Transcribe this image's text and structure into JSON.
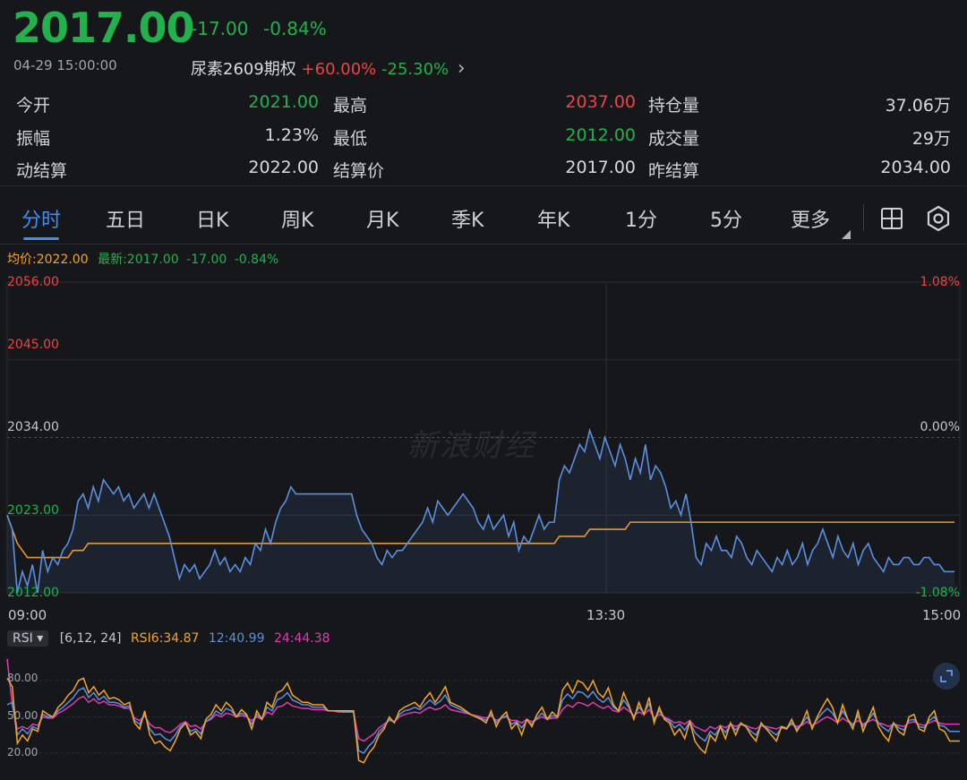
{
  "quote": {
    "price": "2017.00",
    "change": "-17.00",
    "change_pct": "-0.84%",
    "timestamp": "04-29 15:00:00",
    "option_name": "尿素2609期权",
    "option_up": "+60.00%",
    "option_down": "-25.30%",
    "option_arrow": "›"
  },
  "stats": {
    "open_label": "今开",
    "open": "2021.00",
    "high_label": "最高",
    "high": "2037.00",
    "oi_label": "持仓量",
    "oi": "37.06万",
    "amp_label": "振幅",
    "amp": "1.23%",
    "low_label": "最低",
    "low": "2012.00",
    "vol_label": "成交量",
    "vol": "29万",
    "settle_label": "动结算",
    "settle": "2022.00",
    "settle_price_label": "结算价",
    "settle_price": "2017.00",
    "prev_settle_label": "昨结算",
    "prev_settle": "2034.00"
  },
  "tabs": [
    "分时",
    "五日",
    "日K",
    "周K",
    "月K",
    "季K",
    "年K",
    "1分",
    "5分",
    "更多"
  ],
  "legend": {
    "avg": "均价:2022.00",
    "latest": "最新:2017.00",
    "chg": "-17.00",
    "pct": "-0.84%"
  },
  "watermark": "新浪财经",
  "colors": {
    "price_line": "#5b8fe0",
    "avg_line": "#e69a2e",
    "rsi6": "#f5a623",
    "rsi12": "#5b8fe0",
    "rsi24": "#e03bb4",
    "up": "#ef4343",
    "down": "#22b14c"
  },
  "rsi": {
    "select_label": "RSI ▾",
    "params": "[6,12, 24]",
    "rsi6_label": "RSI6:34.87",
    "rsi12_label": "12:40.99",
    "rsi24_label": "24:44.38",
    "ticks": [
      "80.00",
      "50.00",
      "20.00"
    ]
  },
  "chart_data": [
    {
      "type": "line",
      "title": "",
      "y_ticks_left": [
        "2056.00",
        "2045.00",
        "2034.00",
        "2023.00",
        "2012.00"
      ],
      "y_ticks_right": [
        "1.08%",
        "0.00%",
        "-1.08%"
      ],
      "x_ticks": [
        "09:00",
        "13:30",
        "15:00"
      ],
      "ylim": [
        2012,
        2056
      ],
      "reference": 2034,
      "series": [
        {
          "name": "最新",
          "values": [
            2023,
            2021,
            2012,
            2015,
            2013,
            2016,
            2012,
            2018,
            2015,
            2017,
            2016,
            2018,
            2019,
            2021,
            2025,
            2026,
            2024,
            2027,
            2025,
            2028,
            2027,
            2026,
            2027,
            2025,
            2026,
            2024,
            2025,
            2026,
            2024,
            2026,
            2024,
            2022,
            2020,
            2017,
            2014,
            2016,
            2015,
            2016,
            2014,
            2015,
            2016,
            2018,
            2016,
            2017,
            2015,
            2016,
            2015,
            2017,
            2016,
            2019,
            2018,
            2021,
            2019,
            2022,
            2024,
            2025,
            2027,
            2026,
            2026,
            2026,
            2026,
            2026,
            2026,
            2026,
            2026,
            2026,
            2026,
            2026,
            2026,
            2023,
            2021,
            2020,
            2019,
            2017,
            2016,
            2018,
            2017,
            2018,
            2018,
            2019,
            2020,
            2021,
            2022,
            2024,
            2022,
            2025,
            2024,
            2023,
            2024,
            2025,
            2026,
            2025,
            2024,
            2022,
            2021,
            2023,
            2021,
            2022,
            2023,
            2020,
            2022,
            2018,
            2020,
            2019,
            2021,
            2023,
            2021,
            2022,
            2022,
            2028,
            2030,
            2029,
            2031,
            2033,
            2032,
            2035,
            2033,
            2031,
            2034,
            2032,
            2030,
            2033,
            2031,
            2028,
            2031,
            2029,
            2033,
            2028,
            2030,
            2029,
            2027,
            2024,
            2025,
            2023,
            2026,
            2022,
            2017,
            2016,
            2019,
            2018,
            2020,
            2018,
            2018,
            2017,
            2020,
            2019,
            2017,
            2016,
            2018,
            2017,
            2016,
            2015,
            2017,
            2016,
            2018,
            2016,
            2017,
            2019,
            2016,
            2018,
            2019,
            2021,
            2019,
            2017,
            2020,
            2018,
            2017,
            2019,
            2016,
            2018,
            2019,
            2017,
            2016,
            2015,
            2017,
            2016,
            2016,
            2017,
            2017,
            2016,
            2016,
            2017,
            2017,
            2016,
            2016,
            2015,
            2015,
            2015
          ],
          "color_ref": "price_line"
        },
        {
          "name": "均价",
          "values": [
            2023,
            2021,
            2019,
            2018,
            2017,
            2017,
            2017,
            2017,
            2017,
            2017,
            2017,
            2017,
            2017,
            2018,
            2018,
            2018,
            2019,
            2019,
            2019,
            2019,
            2019,
            2019,
            2019,
            2019,
            2019,
            2019,
            2019,
            2019,
            2019,
            2019,
            2019,
            2019,
            2019,
            2019,
            2019,
            2019,
            2019,
            2019,
            2019,
            2019,
            2019,
            2019,
            2019,
            2019,
            2019,
            2019,
            2019,
            2019,
            2019,
            2019,
            2019,
            2019,
            2019,
            2019,
            2019,
            2019,
            2019,
            2019,
            2019,
            2019,
            2019,
            2019,
            2019,
            2019,
            2019,
            2019,
            2019,
            2019,
            2019,
            2019,
            2019,
            2019,
            2019,
            2019,
            2019,
            2019,
            2019,
            2019,
            2019,
            2019,
            2019,
            2019,
            2019,
            2019,
            2019,
            2019,
            2019,
            2019,
            2019,
            2019,
            2019,
            2019,
            2019,
            2019,
            2019,
            2019,
            2019,
            2019,
            2019,
            2019,
            2019,
            2019,
            2019,
            2019,
            2019,
            2019,
            2019,
            2019,
            2019,
            2020,
            2020,
            2020,
            2020,
            2020,
            2020,
            2021,
            2021,
            2021,
            2021,
            2021,
            2021,
            2021,
            2021,
            2022,
            2022,
            2022,
            2022,
            2022,
            2022,
            2022,
            2022,
            2022,
            2022,
            2022,
            2022,
            2022,
            2022,
            2022,
            2022,
            2022,
            2022,
            2022,
            2022,
            2022,
            2022,
            2022,
            2022,
            2022,
            2022,
            2022,
            2022,
            2022,
            2022,
            2022,
            2022,
            2022,
            2022,
            2022,
            2022,
            2022,
            2022,
            2022,
            2022,
            2022,
            2022,
            2022,
            2022,
            2022,
            2022,
            2022,
            2022,
            2022,
            2022,
            2022,
            2022,
            2022,
            2022,
            2022,
            2022,
            2022,
            2022,
            2022,
            2022,
            2022,
            2022,
            2022,
            2022,
            2022
          ],
          "color_ref": "avg_line"
        }
      ]
    },
    {
      "type": "line",
      "title": "",
      "y_ticks": [
        "80.00",
        "50.00",
        "20.00"
      ],
      "ylim": [
        0,
        100
      ],
      "series": [
        {
          "name": "RSI6",
          "values": [
            82,
            75,
            28,
            35,
            30,
            40,
            38,
            55,
            52,
            50,
            58,
            62,
            68,
            72,
            80,
            82,
            70,
            75,
            68,
            72,
            65,
            66,
            64,
            60,
            62,
            45,
            40,
            55,
            35,
            28,
            30,
            25,
            22,
            30,
            40,
            45,
            35,
            38,
            32,
            48,
            52,
            60,
            55,
            62,
            58,
            50,
            56,
            52,
            40,
            55,
            48,
            62,
            58,
            70,
            72,
            78,
            68,
            65,
            62,
            62,
            60,
            60,
            60,
            55,
            55,
            55,
            55,
            55,
            55,
            14,
            12,
            20,
            25,
            35,
            40,
            50,
            45,
            55,
            58,
            60,
            62,
            58,
            65,
            70,
            62,
            68,
            75,
            62,
            60,
            58,
            55,
            52,
            50,
            48,
            45,
            55,
            42,
            50,
            54,
            40,
            45,
            35,
            48,
            42,
            52,
            58,
            48,
            54,
            50,
            72,
            78,
            70,
            80,
            78,
            72,
            80,
            70,
            66,
            74,
            60,
            55,
            70,
            60,
            48,
            62,
            52,
            66,
            45,
            58,
            48,
            45,
            35,
            40,
            32,
            46,
            30,
            24,
            20,
            35,
            30,
            42,
            32,
            45,
            35,
            45,
            42,
            35,
            30,
            45,
            40,
            35,
            30,
            42,
            40,
            48,
            38,
            45,
            55,
            40,
            50,
            58,
            65,
            58,
            45,
            60,
            48,
            40,
            55,
            38,
            48,
            58,
            42,
            35,
            30,
            45,
            38,
            35,
            50,
            52,
            40,
            38,
            50,
            55,
            40,
            38,
            30,
            30,
            30
          ],
          "color_ref": "rsi6"
        },
        {
          "name": "RSI12",
          "values": [
            60,
            62,
            35,
            40,
            36,
            42,
            40,
            52,
            50,
            50,
            55,
            58,
            62,
            66,
            72,
            74,
            66,
            70,
            64,
            67,
            62,
            62,
            61,
            58,
            59,
            47,
            44,
            52,
            40,
            35,
            36,
            32,
            30,
            35,
            42,
            45,
            38,
            40,
            36,
            46,
            49,
            55,
            52,
            57,
            55,
            50,
            53,
            51,
            44,
            52,
            48,
            58,
            55,
            64,
            66,
            70,
            64,
            62,
            60,
            60,
            58,
            58,
            58,
            55,
            55,
            55,
            54,
            54,
            54,
            22,
            20,
            26,
            30,
            38,
            42,
            48,
            46,
            52,
            55,
            56,
            58,
            56,
            60,
            64,
            60,
            63,
            68,
            60,
            58,
            56,
            54,
            52,
            50,
            49,
            47,
            52,
            45,
            49,
            51,
            44,
            46,
            41,
            47,
            44,
            49,
            53,
            48,
            51,
            50,
            64,
            69,
            65,
            71,
            70,
            66,
            71,
            65,
            62,
            66,
            58,
            55,
            64,
            58,
            50,
            58,
            53,
            61,
            48,
            55,
            49,
            47,
            41,
            44,
            39,
            46,
            37,
            33,
            30,
            38,
            35,
            42,
            37,
            44,
            39,
            44,
            42,
            38,
            35,
            43,
            41,
            38,
            35,
            41,
            40,
            45,
            40,
            44,
            50,
            42,
            48,
            53,
            57,
            53,
            46,
            55,
            48,
            43,
            51,
            42,
            47,
            53,
            45,
            41,
            38,
            45,
            41,
            39,
            47,
            48,
            42,
            41,
            47,
            50,
            43,
            42,
            38,
            38,
            38
          ],
          "color_ref": "rsi12"
        },
        {
          "name": "RSI24",
          "values": [
            98,
            60,
            40,
            42,
            40,
            44,
            43,
            50,
            49,
            49,
            53,
            55,
            58,
            61,
            65,
            67,
            62,
            65,
            61,
            63,
            60,
            60,
            59,
            57,
            57,
            49,
            47,
            51,
            44,
            41,
            41,
            38,
            37,
            40,
            44,
            46,
            42,
            43,
            40,
            46,
            48,
            52,
            50,
            53,
            52,
            50,
            51,
            50,
            47,
            50,
            48,
            54,
            52,
            58,
            59,
            62,
            59,
            58,
            57,
            57,
            56,
            56,
            56,
            55,
            55,
            54,
            54,
            54,
            54,
            32,
            30,
            33,
            36,
            41,
            44,
            47,
            46,
            50,
            52,
            53,
            54,
            53,
            56,
            58,
            56,
            57,
            60,
            56,
            55,
            54,
            53,
            52,
            51,
            50,
            49,
            51,
            47,
            49,
            50,
            47,
            47,
            45,
            48,
            46,
            48,
            50,
            48,
            49,
            49,
            56,
            60,
            58,
            62,
            61,
            59,
            62,
            59,
            57,
            59,
            55,
            54,
            58,
            55,
            51,
            54,
            52,
            56,
            49,
            52,
            50,
            48,
            45,
            46,
            44,
            47,
            42,
            40,
            38,
            42,
            40,
            43,
            41,
            44,
            42,
            44,
            43,
            41,
            40,
            43,
            42,
            41,
            40,
            42,
            41,
            44,
            42,
            43,
            46,
            43,
            45,
            48,
            50,
            48,
            45,
            49,
            46,
            44,
            47,
            44,
            46,
            48,
            45,
            44,
            42,
            44,
            43,
            42,
            45,
            46,
            44,
            43,
            45,
            47,
            45,
            44,
            44,
            44,
            44
          ],
          "color_ref": "rsi24"
        }
      ]
    }
  ]
}
